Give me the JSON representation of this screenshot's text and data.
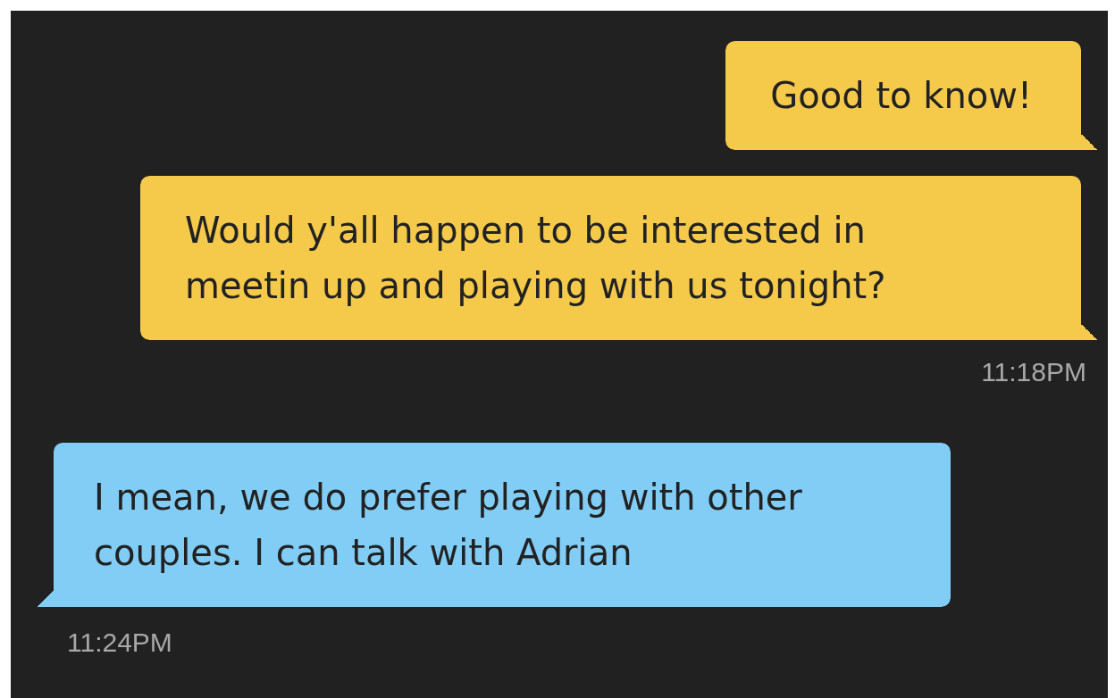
{
  "messages": [
    {
      "kind": "sent",
      "text": "Good to know!"
    },
    {
      "kind": "sent",
      "text": "Would y'all happen to be interested in meetin up and playing with us tonight?",
      "time": "11:18PM"
    },
    {
      "kind": "received",
      "text": "I mean, we do prefer playing with other couples. I can talk with Adrian",
      "time": "11:24PM"
    }
  ]
}
